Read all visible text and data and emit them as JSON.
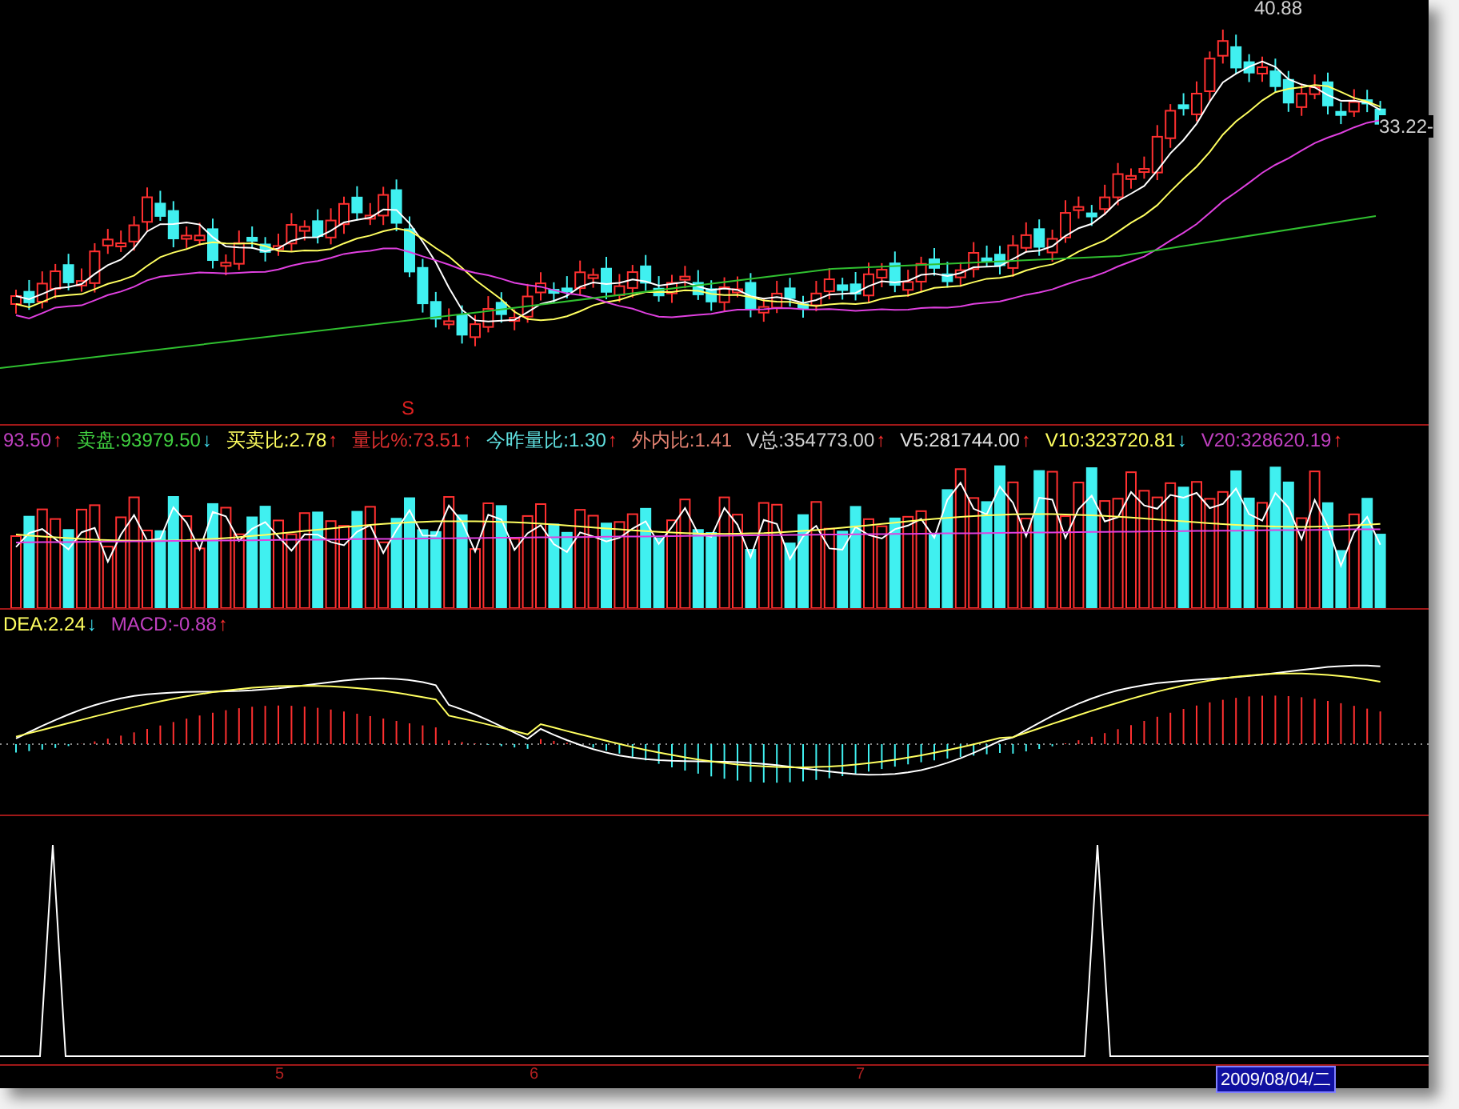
{
  "price_panel": {
    "high_label": "40.88",
    "last_label": "33.22-",
    "marker": "S"
  },
  "volume_panel": {
    "indicators": [
      {
        "text": "93.50",
        "color": "#c040c0",
        "arrow": {
          "kind": "up",
          "symbol": "↑"
        }
      },
      {
        "text": "卖盘:93979.50",
        "color": "#40d040",
        "arrow": {
          "kind": "down",
          "symbol": "↓"
        }
      },
      {
        "text": "买卖比:2.78",
        "color": "#ffff60",
        "arrow": {
          "kind": "up",
          "symbol": "↑"
        }
      },
      {
        "text": "量比%:73.51",
        "color": "#e03030",
        "arrow": {
          "kind": "up",
          "symbol": "↑"
        }
      },
      {
        "text": "今昨量比:1.30",
        "color": "#60e0e0",
        "arrow": {
          "kind": "up",
          "symbol": "↑"
        }
      },
      {
        "text": "外内比:1.41",
        "color": "#e08070"
      },
      {
        "text": "V总:354773.00",
        "color": "#d0d0d0",
        "arrow": {
          "kind": "up",
          "symbol": "↑"
        }
      },
      {
        "text": "V5:281744.00",
        "color": "#e0e0e0",
        "arrow": {
          "kind": "up",
          "symbol": "↑"
        }
      },
      {
        "text": "V10:323720.81",
        "color": "#ffff60",
        "arrow": {
          "kind": "down",
          "symbol": "↓"
        }
      },
      {
        "text": "V20:328620.19",
        "color": "#c040c0",
        "arrow": {
          "kind": "up",
          "symbol": "↑"
        }
      }
    ]
  },
  "macd_panel": {
    "indicators": [
      {
        "text": "DEA:2.24",
        "color": "#ffff60",
        "arrow": {
          "kind": "down",
          "symbol": "↓"
        }
      },
      {
        "text": "MACD:-0.88",
        "color": "#c040c0",
        "arrow": {
          "kind": "up",
          "symbol": "↑"
        }
      }
    ]
  },
  "time_axis": {
    "labels": [
      "5",
      "6",
      "7"
    ],
    "date": "2009/08/04/二"
  }
}
